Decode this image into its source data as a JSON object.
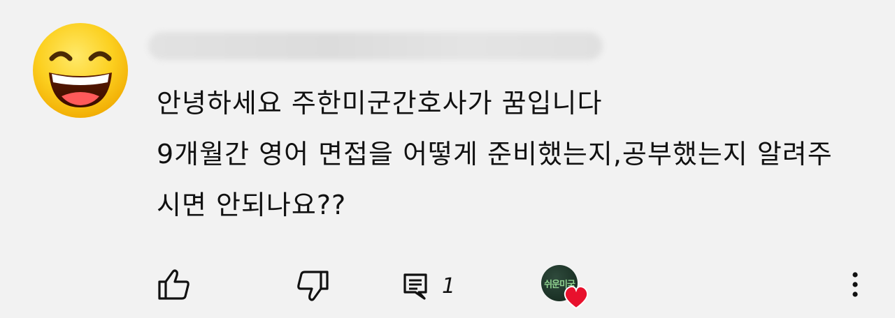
{
  "comment": {
    "author_avatar_icon": "grinning-face-emoji",
    "text_lines": [
      "안녕하세요 주한미군간호사가 꿈입니다",
      "9개월간 영어 면접을 어떻게 준비했는지,공부했는지 알려주",
      "시면 안되나요??"
    ]
  },
  "actions": {
    "like_icon": "thumbs-up-icon",
    "dislike_icon": "thumbs-down-icon",
    "reply_icon": "comment-icon",
    "reply_count": "1",
    "creator_avatar_label": "쉬운미국",
    "creator_heart_icon": "heart-icon",
    "heart_color": "#e8112d",
    "more_icon": "more-vertical-icon"
  }
}
